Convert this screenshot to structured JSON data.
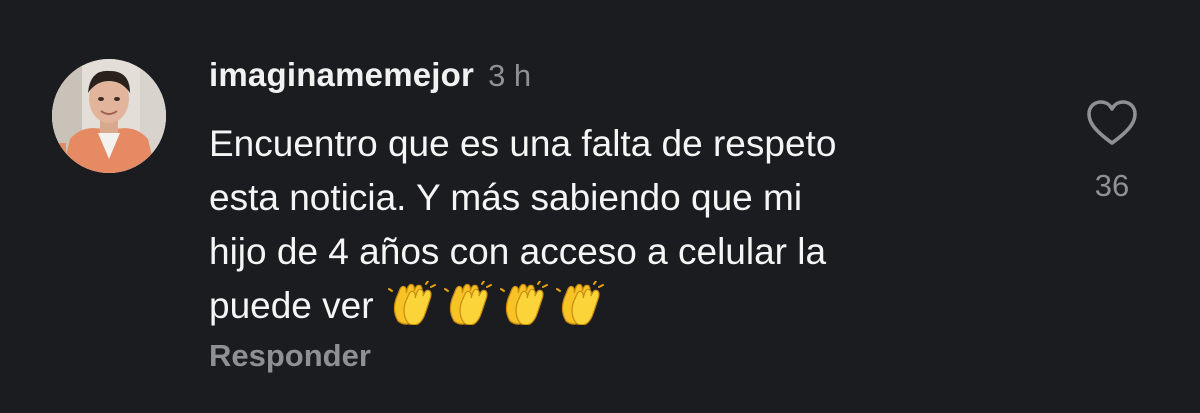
{
  "comment": {
    "username": "imaginamemejor",
    "timestamp": "3 h",
    "text_lines": [
      "Encuentro que es una falta de respeto",
      "esta noticia. Y más sabiendo que mi",
      "hijo de 4 años con acceso a celular la",
      "puede ver"
    ],
    "emojis": [
      "clapping-hands",
      "clapping-hands",
      "clapping-hands",
      "clapping-hands"
    ],
    "reply_label": "Responder",
    "like_count": "36",
    "like_icon": "heart-outline-icon"
  },
  "colors": {
    "background": "#1b1c20",
    "primary_text": "#f5f5f5",
    "secondary_text": "#8e9096"
  }
}
